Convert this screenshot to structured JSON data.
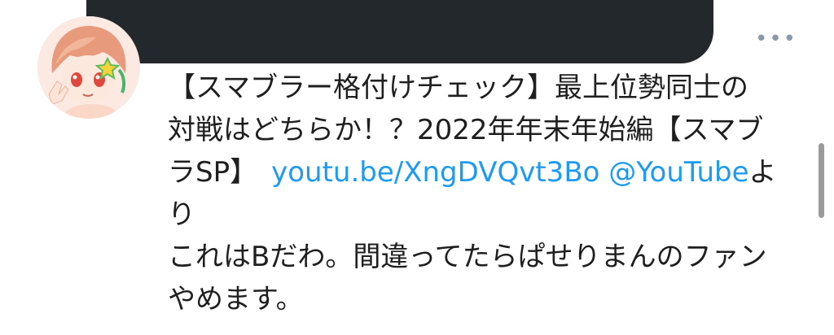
{
  "tweet": {
    "text": {
      "line1": "【スマブラー格付けチェック】最上位勢同士の",
      "line2": "対戦はどちらか！？2022年年末年始編【スマブ",
      "line3_start": "ラSP】",
      "link_url": "youtu.be/XngDVQvt3Bo",
      "link_mention": "@YouTube",
      "line3_end": "よ",
      "line4": "り",
      "line5": "これはBだわ。間違ってたらぱせりまんのファン",
      "line6": "やめます。"
    },
    "more_label": "•••"
  },
  "colors": {
    "link": "#1d9bf0",
    "text": "#1f1f1f",
    "redaction": "#23282d",
    "icon_gray": "#8b98a5"
  },
  "icons": {
    "more": "more-horizontal-icon",
    "avatar": "user-avatar-image"
  }
}
